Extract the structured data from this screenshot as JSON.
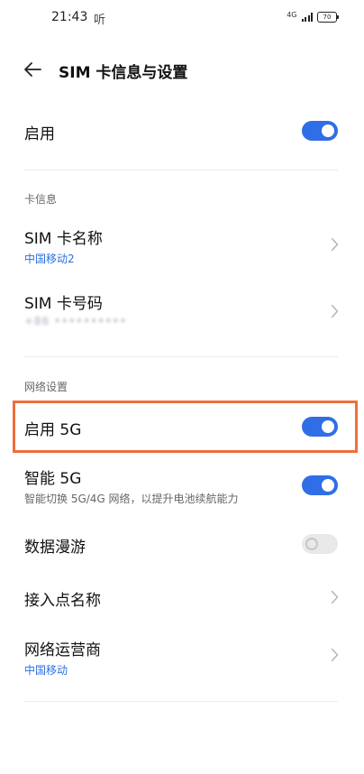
{
  "status_bar": {
    "time": "21:43",
    "notification_glyph": "听",
    "network_label": "4G",
    "battery_level": "70"
  },
  "header": {
    "title": "SIM 卡信息与设置"
  },
  "enable_row": {
    "label": "启用",
    "enabled": true
  },
  "card_info": {
    "section_title": "卡信息",
    "sim_name": {
      "label": "SIM 卡名称",
      "value": "中国移动2"
    },
    "sim_number": {
      "label": "SIM 卡号码",
      "value": "+86 ••••••••••"
    }
  },
  "network_settings": {
    "section_title": "网络设置",
    "enable_5g": {
      "label": "启用 5G",
      "enabled": true
    },
    "smart_5g": {
      "label": "智能 5G",
      "description": "智能切换 5G/4G 网络，以提升电池续航能力",
      "enabled": true
    },
    "data_roaming": {
      "label": "数据漫游",
      "enabled": false
    },
    "apn": {
      "label": "接入点名称"
    },
    "carrier": {
      "label": "网络运营商",
      "value": "中国移动"
    }
  },
  "colors": {
    "accent": "#2f6ee6",
    "link_blue": "#2b6fe0",
    "highlight": "#ee6f3b"
  }
}
